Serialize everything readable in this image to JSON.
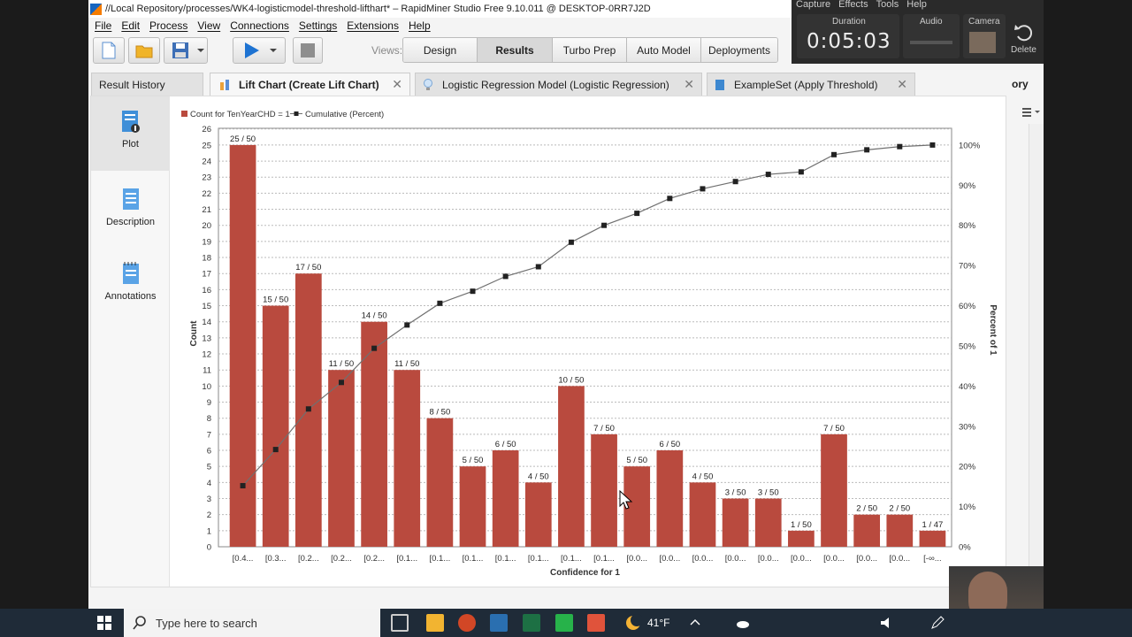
{
  "window": {
    "title": "//Local Repository/processes/WK4-logisticmodel-threshold-lifthart* – RapidMiner Studio Free 9.10.011 @ DESKTOP-0RR7J2D"
  },
  "menu": [
    "File",
    "Edit",
    "Process",
    "View",
    "Connections",
    "Settings",
    "Extensions",
    "Help"
  ],
  "toolbar": {
    "views_label": "Views:",
    "views": [
      "Design",
      "Results",
      "Turbo Prep",
      "Auto Model",
      "Deployments"
    ],
    "active_view": "Results"
  },
  "recorder": {
    "menu": [
      "Capture",
      "Effects",
      "Tools",
      "Help"
    ],
    "duration_label": "Duration",
    "duration": "0:05:03",
    "audio_label": "Audio",
    "camera_label": "Camera",
    "delete_label": "Delete"
  },
  "result_tabs": {
    "history": "Result History",
    "tabs": [
      "Lift Chart (Create Lift Chart)",
      "Logistic Regression Model (Logistic Regression)",
      "ExampleSet (Apply Threshold)"
    ],
    "overflow": "ory"
  },
  "sidenav": [
    "Plot",
    "Description",
    "Annotations"
  ],
  "chart_data": {
    "type": "bar",
    "legend": [
      "Count for TenYearCHD = 1",
      "Cumulative (Percent)"
    ],
    "xlabel": "Confidence for 1",
    "ylabel": "Count",
    "y2label": "Percent of 1",
    "ylim": [
      0,
      26
    ],
    "y2lim": [
      0,
      100
    ],
    "categories": [
      "[0.4...",
      "[0.3...",
      "[0.2...",
      "[0.2...",
      "[0.2...",
      "[0.1...",
      "[0.1...",
      "[0.1...",
      "[0.1...",
      "[0.1...",
      "[0.1...",
      "[0.1...",
      "[0.0...",
      "[0.0...",
      "[0.0...",
      "[0.0...",
      "[0.0...",
      "[0.0...",
      "[0.0...",
      "[0.0...",
      "[0.0...",
      "[-∞..."
    ],
    "values": [
      25,
      15,
      17,
      11,
      14,
      11,
      8,
      5,
      6,
      4,
      10,
      7,
      5,
      6,
      4,
      3,
      3,
      1,
      7,
      2,
      2,
      1
    ],
    "data_labels": [
      "25 / 50",
      "15 / 50",
      "17 / 50",
      "11 / 50",
      "14 / 50",
      "11 / 50",
      "8 / 50",
      "5 / 50",
      "6 / 50",
      "4 / 50",
      "10 / 50",
      "7 / 50",
      "5 / 50",
      "6 / 50",
      "4 / 50",
      "3 / 50",
      "3 / 50",
      "1 / 50",
      "7 / 50",
      "2 / 50",
      "2 / 50",
      "1 / 47"
    ],
    "cumulative_percent": [
      15.2,
      24.2,
      34.3,
      40.9,
      49.4,
      55.2,
      60.6,
      63.6,
      67.3,
      69.7,
      75.8,
      80.0,
      83.0,
      86.7,
      89.1,
      90.9,
      92.7,
      93.3,
      97.6,
      98.8,
      99.6,
      100.0
    ],
    "y_ticks": [
      0,
      1,
      2,
      3,
      4,
      5,
      6,
      7,
      8,
      9,
      10,
      11,
      12,
      13,
      14,
      15,
      16,
      17,
      18,
      19,
      20,
      21,
      22,
      23,
      24,
      25,
      26
    ],
    "y2_ticks": [
      "0%",
      "10%",
      "20%",
      "30%",
      "40%",
      "50%",
      "60%",
      "70%",
      "80%",
      "90%",
      "100%"
    ],
    "colors": {
      "bar": "#b94a3e",
      "line": "#707070",
      "marker": "#222222"
    }
  },
  "taskbar": {
    "search_placeholder": "Type here to search",
    "weather": "41°F"
  }
}
